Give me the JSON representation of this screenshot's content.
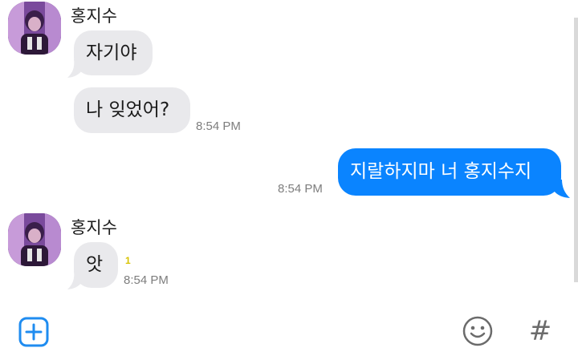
{
  "messages": [
    {
      "sender": "홍지수",
      "text": "자기야"
    },
    {
      "text": "나 잊었어?",
      "time": "8:54 PM"
    },
    {
      "text": "지랄하지마 너 홍지수지",
      "time": "8:54 PM"
    },
    {
      "sender": "홍지수",
      "text": "앗",
      "time": "8:54 PM",
      "unread": "1"
    }
  ],
  "composer": {
    "add_icon": "plus-square-icon",
    "emoji_icon": "smiley-icon",
    "hashtag_label": "#"
  },
  "colors": {
    "outgoing_bubble": "#0a84ff",
    "incoming_bubble": "#e9e9ec",
    "unread_badge": "#d8c300",
    "accent_icon": "#1f8cf0"
  }
}
